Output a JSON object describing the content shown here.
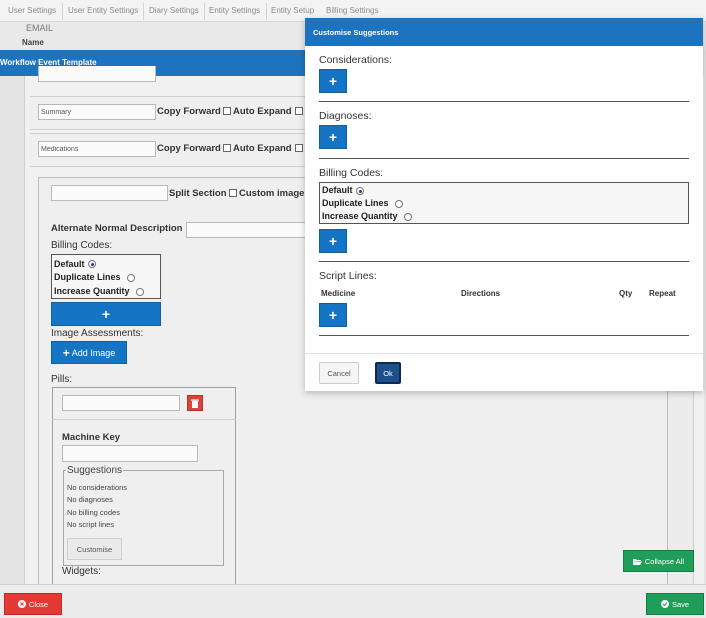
{
  "tabs": [
    "User Settings",
    "User Entity Settings",
    "Diary Settings",
    "Entity Settings",
    "Entity Setup",
    "Billing Settings"
  ],
  "header": {
    "email_label": "EMAIL",
    "name_label": "Name"
  },
  "workflow_title": "Workflow Event Template",
  "rows": [
    {
      "value": "Summary",
      "copy_forward": "Copy Forward",
      "auto_expand": "Auto Expand"
    },
    {
      "value": "Medications",
      "copy_forward": "Copy Forward",
      "auto_expand": "Auto Expand"
    }
  ],
  "section": {
    "split_section": "Split Section",
    "custom_image": "Custom image",
    "alternate_normal_description": "Alternate Normal Description",
    "billing_codes_label": "Billing Codes:",
    "billing_options": [
      "Default",
      "Duplicate Lines",
      "Increase Quantity"
    ],
    "add_symbol": "+",
    "image_assessments_label": "Image Assessments:",
    "add_image": "Add Image",
    "pills_label": "Pills:",
    "machine_key": "Machine Key",
    "suggestions_legend": "Suggestions",
    "suggestions": [
      "No considerations",
      "No diagnoses",
      "No billing codes",
      "No script lines"
    ],
    "customise": "Customise",
    "widgets_label": "Widgets:"
  },
  "buttons": {
    "collapse_all": "Collapse All",
    "close": "Close",
    "save": "Save"
  },
  "modal": {
    "title": "Customise Suggestions",
    "considerations_label": "Considerations:",
    "diagnoses_label": "Diagnoses:",
    "billing_codes_label": "Billing Codes:",
    "billing_options": [
      "Default",
      "Duplicate Lines",
      "Increase Quantity"
    ],
    "billing_selected": "Default",
    "script_lines_label": "Script Lines:",
    "script_columns": [
      "Medicine",
      "Directions",
      "Qty",
      "Repeat"
    ],
    "add_symbol": "+",
    "cancel": "Cancel",
    "ok": "Ok"
  },
  "colors": {
    "primary": "#1e73be",
    "success": "#1f9e5a",
    "danger": "#e53935"
  },
  "icons": [
    "plus-icon",
    "trash-icon",
    "folder-open-icon",
    "close-circle-icon",
    "check-circle-icon",
    "radio-selected-icon"
  ]
}
